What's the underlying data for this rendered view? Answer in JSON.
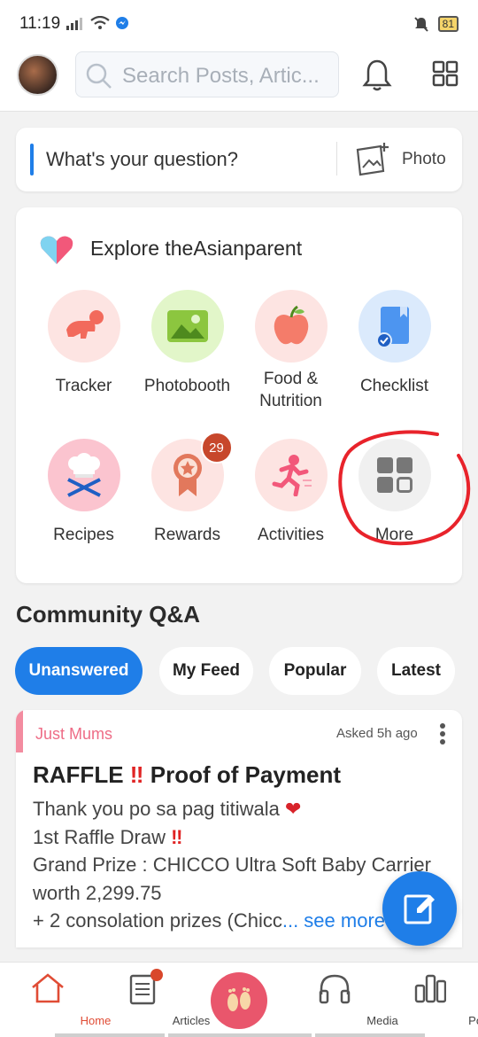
{
  "status_bar": {
    "time": "11:19",
    "battery": "81"
  },
  "header": {
    "search_placeholder": "Search Posts, Artic..."
  },
  "question": {
    "prompt": "What's your question?",
    "photo_label": "Photo"
  },
  "explore": {
    "title": "Explore theAsianparent",
    "tiles": [
      {
        "label": "Tracker",
        "icon": "baby-crawl-icon"
      },
      {
        "label": "Photobooth",
        "icon": "image-icon"
      },
      {
        "label": "Food &\nNutrition",
        "icon": "apple-icon"
      },
      {
        "label": "Checklist",
        "icon": "checklist-icon"
      },
      {
        "label": "Recipes",
        "icon": "chef-hat-icon"
      },
      {
        "label": "Rewards",
        "icon": "ribbon-icon",
        "badge": "29"
      },
      {
        "label": "Activities",
        "icon": "runner-icon"
      },
      {
        "label": "More",
        "icon": "grid-icon"
      }
    ]
  },
  "community": {
    "title": "Community Q&A",
    "filters": [
      "Unanswered",
      "My Feed",
      "Popular",
      "Latest"
    ],
    "active_filter": "Unanswered"
  },
  "post": {
    "group": "Just Mums",
    "time": "Asked 5h ago",
    "title_a": "RAFFLE",
    "title_b": "Proof of Payment",
    "lines": [
      "Thank you po sa pag titiwala",
      "1st Raffle Draw",
      "Grand Prize : CHICCO Ultra Soft Baby Carrier",
      "worth 2,299.75",
      "+ 2 consolation prizes (Chicc"
    ],
    "see_more": "... see more"
  },
  "bottom_nav": {
    "items": [
      {
        "label": "Home"
      },
      {
        "label": "Articles"
      },
      {
        "label": ""
      },
      {
        "label": "Media"
      },
      {
        "label": "Poll"
      }
    ]
  },
  "colors": {
    "accent": "#1f7ee8",
    "brand_red": "#e04c35",
    "pink": "#ee6c86"
  }
}
